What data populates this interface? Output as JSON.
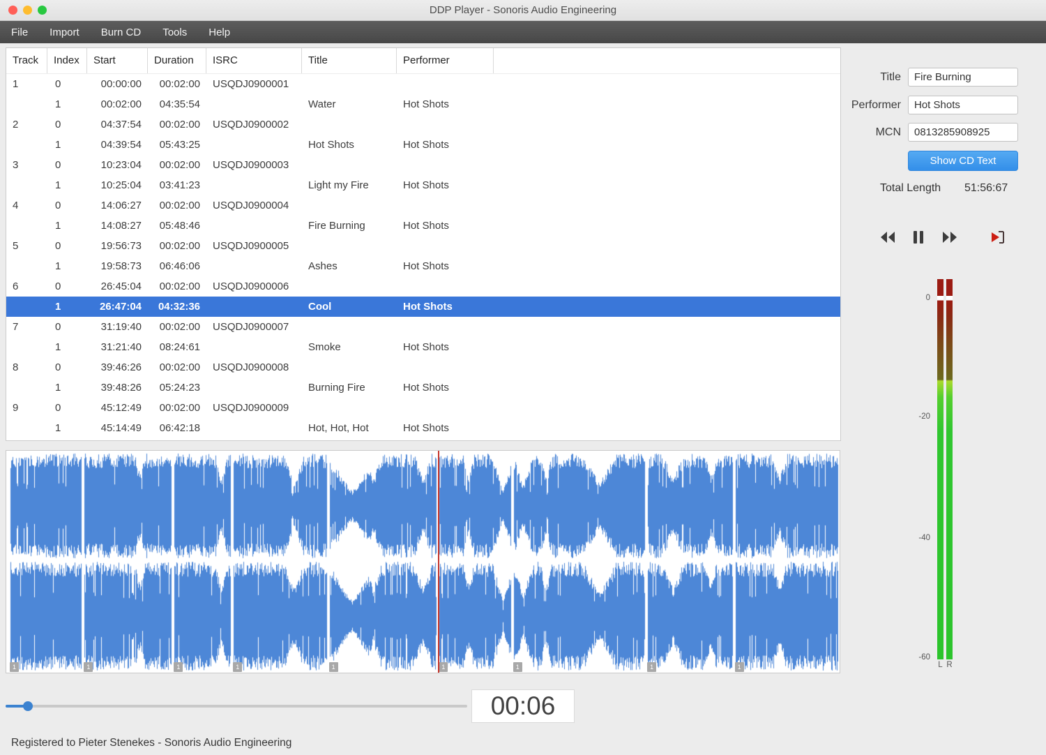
{
  "window": {
    "title": "DDP Player - Sonoris Audio Engineering",
    "status_bar": "Registered to Pieter Stenekes - Sonoris Audio Engineering"
  },
  "menu": {
    "items": [
      "File",
      "Import",
      "Burn CD",
      "Tools",
      "Help"
    ]
  },
  "track_table": {
    "columns": [
      "Track",
      "Index",
      "Start",
      "Duration",
      "ISRC",
      "Title",
      "Performer"
    ],
    "rows": [
      {
        "track": "1",
        "index": "0",
        "start": "00:00:00",
        "duration": "00:02:00",
        "isrc": "USQDJ0900001",
        "title": "",
        "performer": ""
      },
      {
        "track": "",
        "index": "1",
        "start": "00:02:00",
        "duration": "04:35:54",
        "isrc": "",
        "title": "Water",
        "performer": "Hot Shots"
      },
      {
        "track": "2",
        "index": "0",
        "start": "04:37:54",
        "duration": "00:02:00",
        "isrc": "USQDJ0900002",
        "title": "",
        "performer": ""
      },
      {
        "track": "",
        "index": "1",
        "start": "04:39:54",
        "duration": "05:43:25",
        "isrc": "",
        "title": "Hot Shots",
        "performer": "Hot Shots"
      },
      {
        "track": "3",
        "index": "0",
        "start": "10:23:04",
        "duration": "00:02:00",
        "isrc": "USQDJ0900003",
        "title": "",
        "performer": ""
      },
      {
        "track": "",
        "index": "1",
        "start": "10:25:04",
        "duration": "03:41:23",
        "isrc": "",
        "title": "Light my Fire",
        "performer": "Hot Shots"
      },
      {
        "track": "4",
        "index": "0",
        "start": "14:06:27",
        "duration": "00:02:00",
        "isrc": "USQDJ0900004",
        "title": "",
        "performer": ""
      },
      {
        "track": "",
        "index": "1",
        "start": "14:08:27",
        "duration": "05:48:46",
        "isrc": "",
        "title": "Fire Burning",
        "performer": "Hot Shots"
      },
      {
        "track": "5",
        "index": "0",
        "start": "19:56:73",
        "duration": "00:02:00",
        "isrc": "USQDJ0900005",
        "title": "",
        "performer": ""
      },
      {
        "track": "",
        "index": "1",
        "start": "19:58:73",
        "duration": "06:46:06",
        "isrc": "",
        "title": "Ashes",
        "performer": "Hot Shots"
      },
      {
        "track": "6",
        "index": "0",
        "start": "26:45:04",
        "duration": "00:02:00",
        "isrc": "USQDJ0900006",
        "title": "",
        "performer": ""
      },
      {
        "track": "",
        "index": "1",
        "start": "26:47:04",
        "duration": "04:32:36",
        "isrc": "",
        "title": "Cool",
        "performer": "Hot Shots",
        "selected": true
      },
      {
        "track": "7",
        "index": "0",
        "start": "31:19:40",
        "duration": "00:02:00",
        "isrc": "USQDJ0900007",
        "title": "",
        "performer": ""
      },
      {
        "track": "",
        "index": "1",
        "start": "31:21:40",
        "duration": "08:24:61",
        "isrc": "",
        "title": "Smoke",
        "performer": "Hot Shots"
      },
      {
        "track": "8",
        "index": "0",
        "start": "39:46:26",
        "duration": "00:02:00",
        "isrc": "USQDJ0900008",
        "title": "",
        "performer": ""
      },
      {
        "track": "",
        "index": "1",
        "start": "39:48:26",
        "duration": "05:24:23",
        "isrc": "",
        "title": "Burning Fire",
        "performer": "Hot Shots"
      },
      {
        "track": "9",
        "index": "0",
        "start": "45:12:49",
        "duration": "00:02:00",
        "isrc": "USQDJ0900009",
        "title": "",
        "performer": ""
      },
      {
        "track": "",
        "index": "1",
        "start": "45:14:49",
        "duration": "06:42:18",
        "isrc": "",
        "title": "Hot, Hot, Hot",
        "performer": "Hot Shots"
      }
    ]
  },
  "inspector": {
    "title_label": "Title",
    "title_value": "Fire Burning",
    "performer_label": "Performer",
    "performer_value": "Hot Shots",
    "mcn_label": "MCN",
    "mcn_value": "0813285908925",
    "show_cd_text_button": "Show CD Text",
    "total_length_label": "Total Length",
    "total_length_value": "51:56:67"
  },
  "transport": {
    "time_display": "00:06",
    "icons": [
      "rewind",
      "pause",
      "fast-forward",
      "play-to-marker"
    ]
  },
  "meters": {
    "scale_labels": [
      "0",
      "-20",
      "-40",
      "-60"
    ],
    "channel_labels": [
      "L",
      "R"
    ]
  },
  "waveform": {
    "marker_label": "1",
    "marker_fractions": [
      0.005,
      0.094,
      0.202,
      0.273,
      0.388,
      0.52,
      0.609,
      0.77,
      0.875
    ],
    "playhead_fraction": 0.518
  },
  "slider": {
    "fraction": 0.048
  },
  "colors": {
    "selection_blue": "#3a77d9",
    "button_blue": "#3f9bef",
    "waveform_blue": "#4d87d7",
    "playhead_red": "#c5342a",
    "meter_green": "#2cc42c",
    "meter_red": "#9b1b12"
  }
}
